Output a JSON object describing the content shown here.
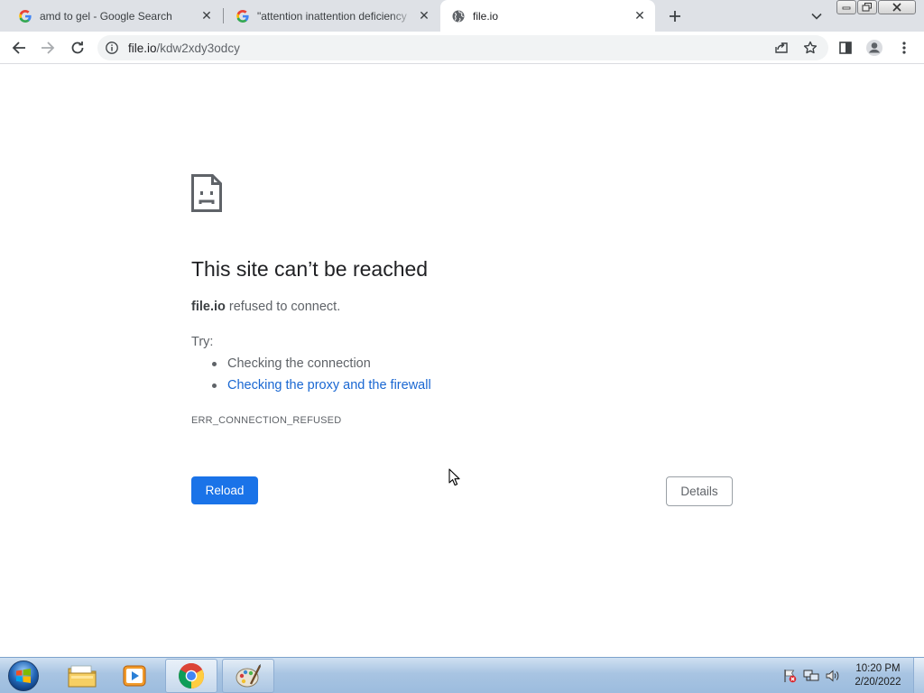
{
  "tabs": [
    {
      "title": "amd to gel - Google Search",
      "favicon": "google-g-icon",
      "active": false
    },
    {
      "title": "\"attention inattention deficiency",
      "favicon": "google-g-icon",
      "active": false
    },
    {
      "title": "file.io",
      "favicon": "globe-icon",
      "active": true
    }
  ],
  "tabstrip": {
    "new_tab_icon": "plus-icon",
    "tab_search_icon": "chevron-down-icon"
  },
  "toolbar": {
    "back_icon": "arrow-left-icon",
    "forward_icon": "arrow-right-icon",
    "reload_icon": "reload-icon",
    "site_info_icon": "info-icon",
    "url_host": "file.io",
    "url_path": "/kdw2xdy3odcy",
    "share_icon": "share-icon",
    "bookmark_icon": "star-icon",
    "side_panel_icon": "side-panel-icon",
    "profile_icon": "avatar-icon",
    "menu_icon": "kebab-menu-icon"
  },
  "error": {
    "title": "This site can’t be reached",
    "host": "file.io",
    "message": " refused to connect.",
    "try_label": "Try:",
    "suggestions": [
      {
        "text": "Checking the connection",
        "link": false
      },
      {
        "text": "Checking the proxy and the firewall",
        "link": true
      }
    ],
    "code": "ERR_CONNECTION_REFUSED",
    "reload_label": "Reload",
    "details_label": "Details"
  },
  "taskbar": {
    "items": [
      {
        "name": "start-orb-icon"
      },
      {
        "name": "file-explorer-icon"
      },
      {
        "name": "media-player-icon"
      },
      {
        "name": "chrome-icon"
      },
      {
        "name": "paint-icon"
      }
    ],
    "tray_icons": [
      "action-center-flag-icon",
      "network-icon",
      "volume-icon"
    ],
    "time": "10:20 PM",
    "date": "2/20/2022"
  },
  "colors": {
    "tabstrip_bg": "#dee1e6",
    "accent_blue": "#1a73e8",
    "link_blue": "#1967d2",
    "text_dark": "#202124",
    "text_muted": "#5f6368"
  }
}
